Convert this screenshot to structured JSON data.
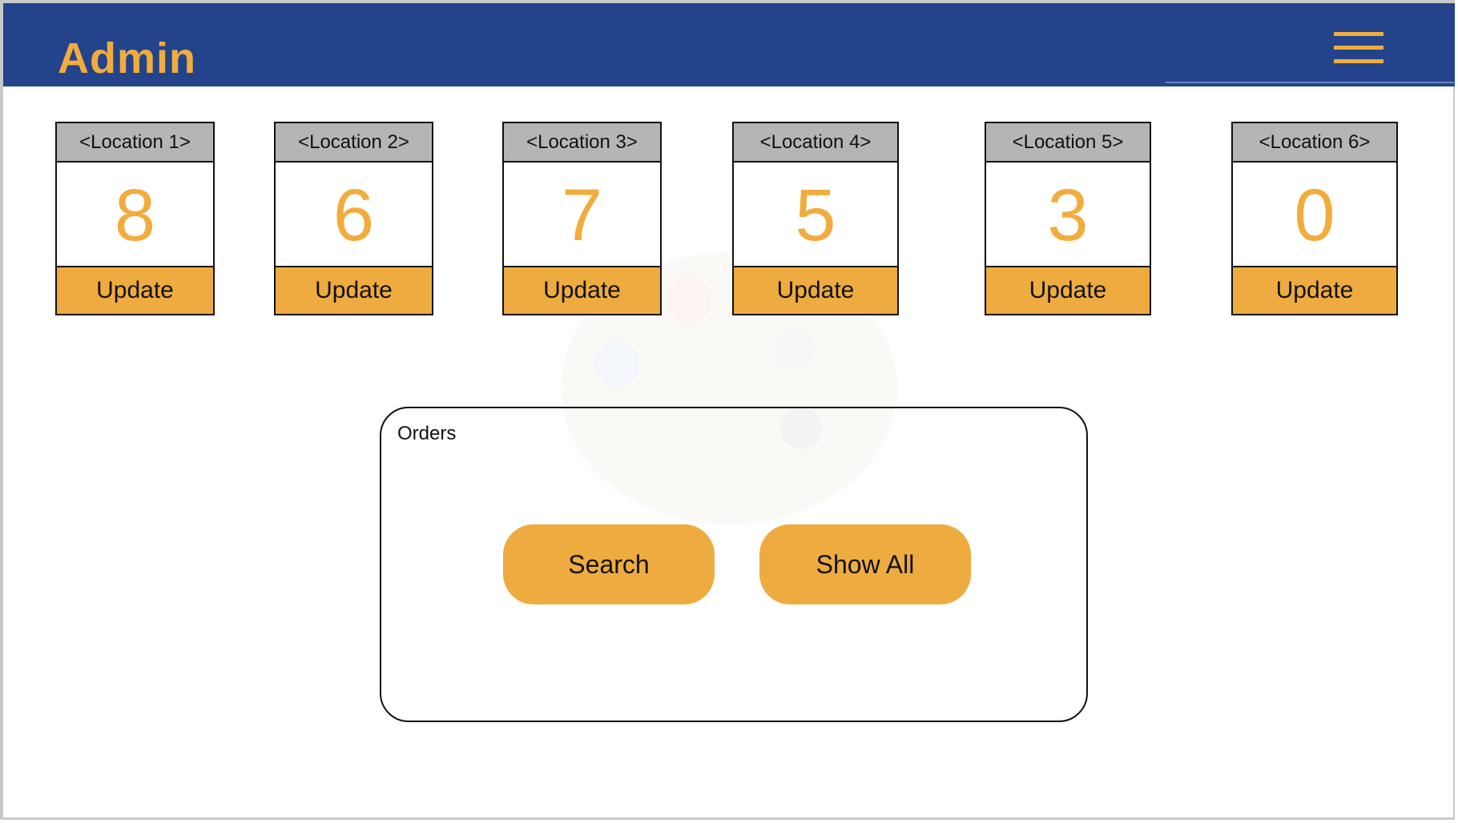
{
  "header": {
    "title": "Admin",
    "menu_icon": "hamburger-menu-icon"
  },
  "locations": [
    {
      "label": "<Location 1>",
      "count": "8",
      "action": "Update"
    },
    {
      "label": "<Location 2>",
      "count": "6",
      "action": "Update"
    },
    {
      "label": "<Location 3>",
      "count": "7",
      "action": "Update"
    },
    {
      "label": "<Location 4>",
      "count": "5",
      "action": "Update"
    },
    {
      "label": "<Location 5>",
      "count": "3",
      "action": "Update"
    },
    {
      "label": "<Location 6>",
      "count": "0",
      "action": "Update"
    }
  ],
  "orders": {
    "title": "Orders",
    "search_label": "Search",
    "show_all_label": "Show All"
  },
  "colors": {
    "header_bg": "#23448a",
    "accent": "#eeab40",
    "card_header_bg": "#b5b5b5"
  }
}
